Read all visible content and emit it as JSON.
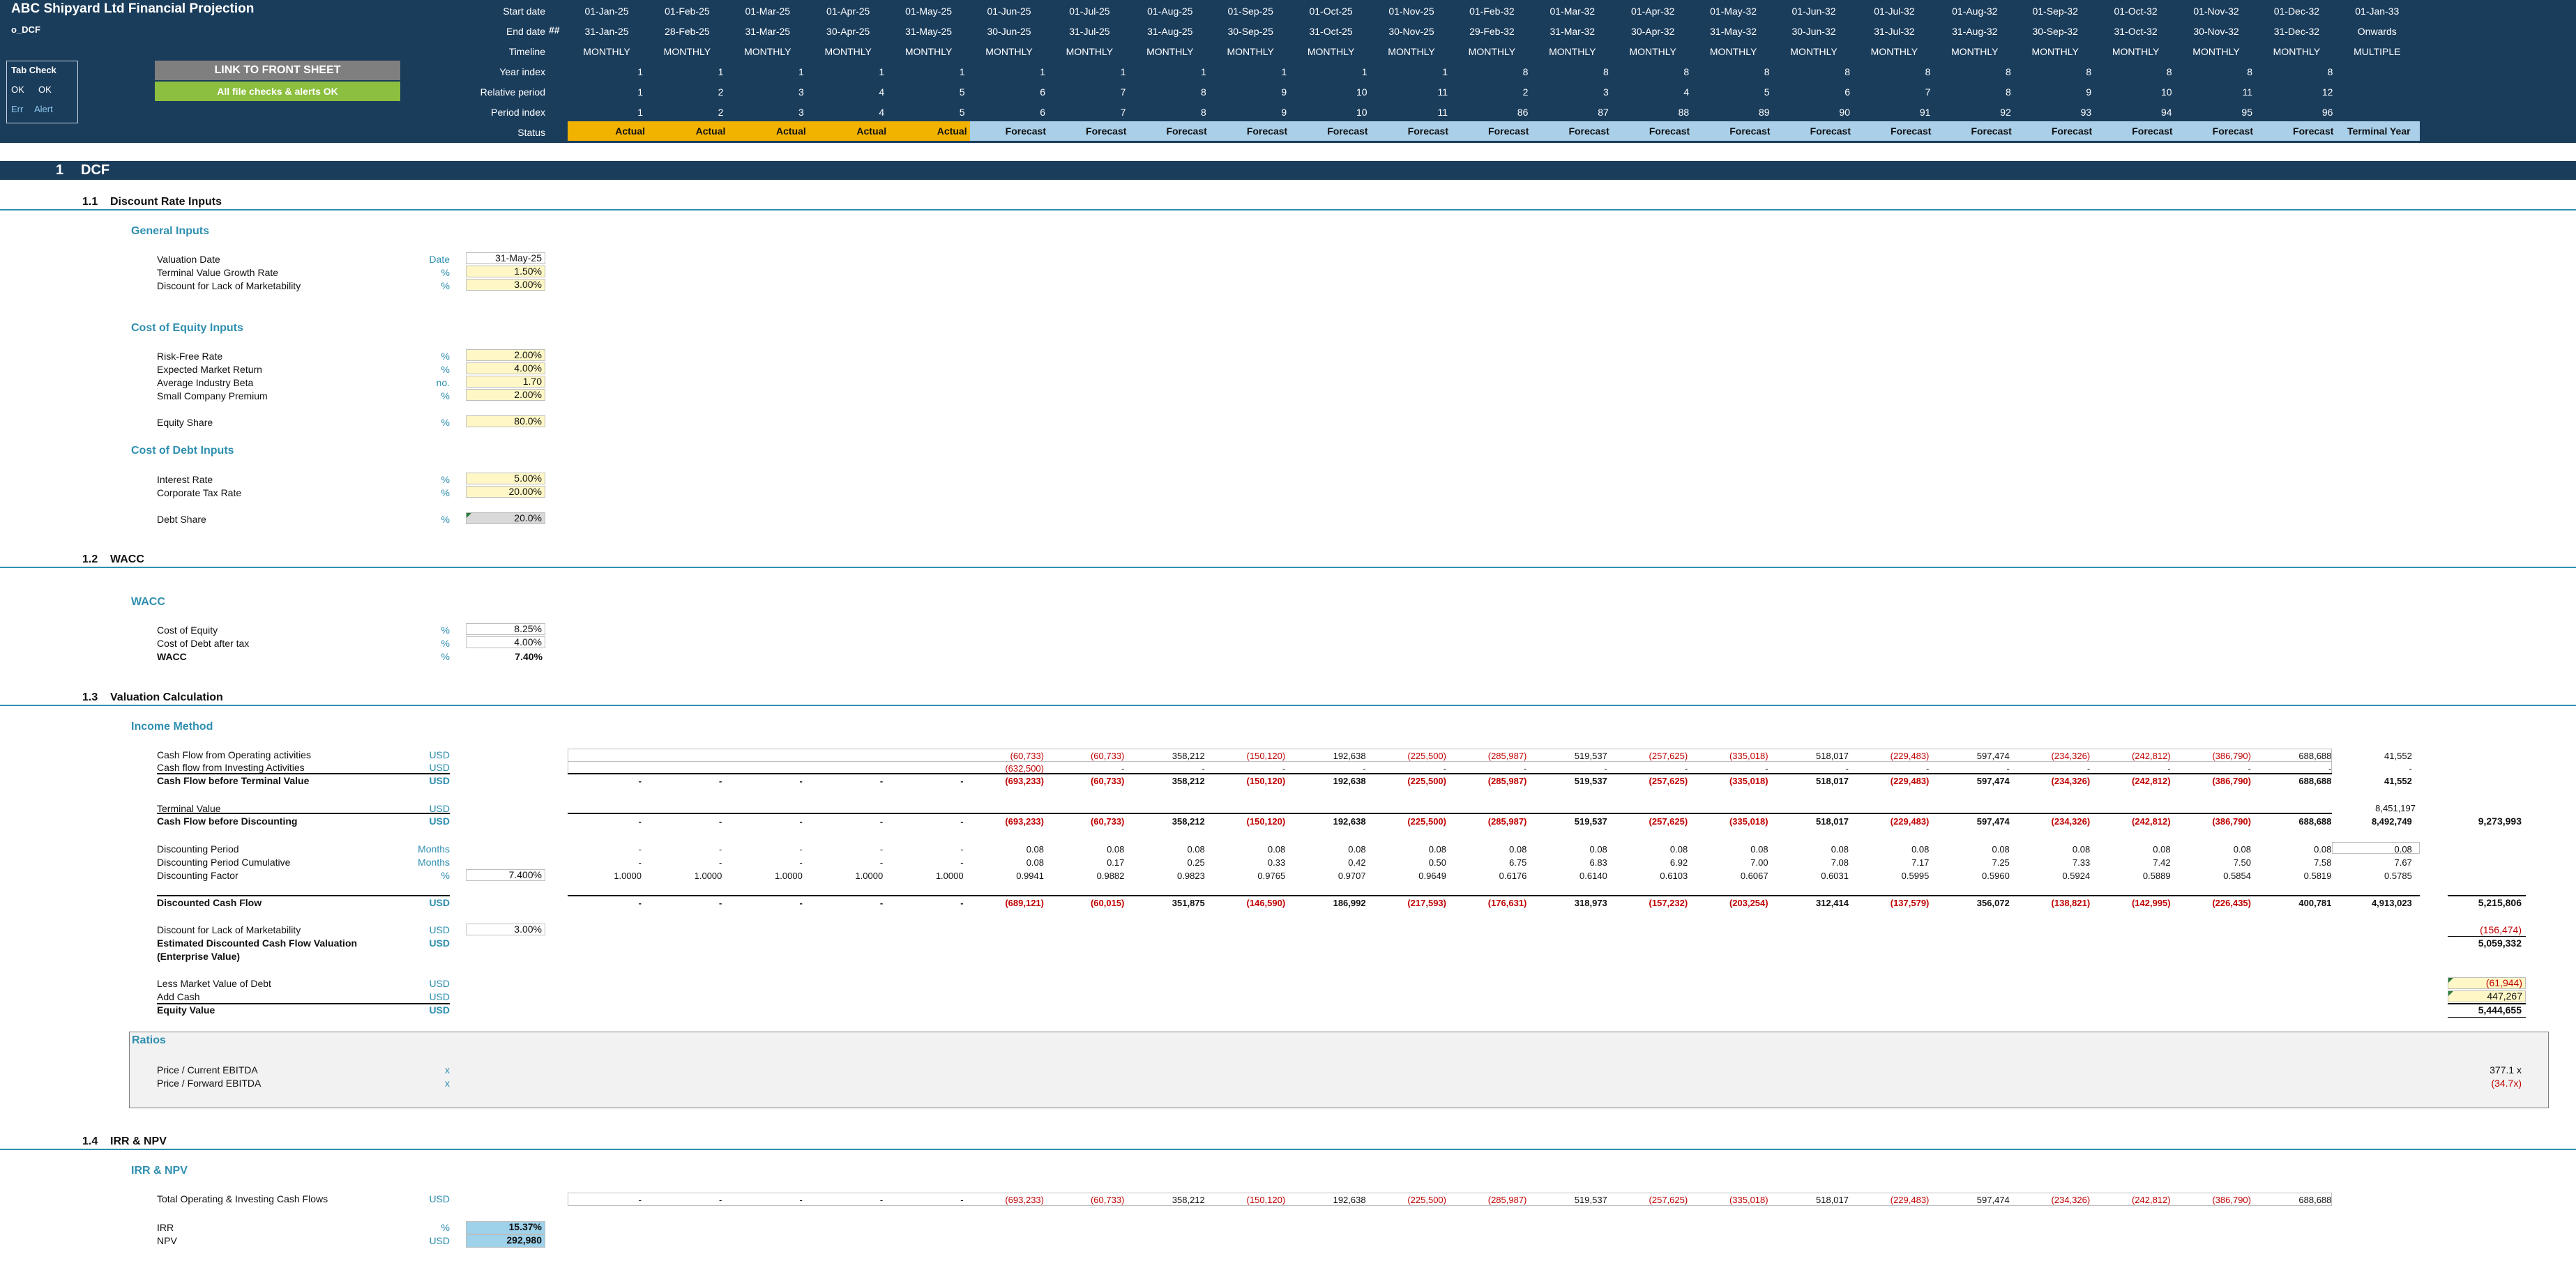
{
  "header": {
    "title": "ABC Shipyard Ltd Financial Projection",
    "sheet": "o_DCF",
    "row_labels": [
      "Start date",
      "End date",
      "Timeline",
      "Year index",
      "Relative period",
      "Period index",
      "Status"
    ],
    "end_date_marker": "##",
    "start_dates": [
      "01-Jan-25",
      "01-Feb-25",
      "01-Mar-25",
      "01-Apr-25",
      "01-May-25",
      "01-Jun-25",
      "01-Jul-25",
      "01-Aug-25",
      "01-Sep-25",
      "01-Oct-25",
      "01-Nov-25",
      "01-Feb-32",
      "01-Mar-32",
      "01-Apr-32",
      "01-May-32",
      "01-Jun-32",
      "01-Jul-32",
      "01-Aug-32",
      "01-Sep-32",
      "01-Oct-32",
      "01-Nov-32",
      "01-Dec-32",
      "01-Jan-33"
    ],
    "end_dates": [
      "31-Jan-25",
      "28-Feb-25",
      "31-Mar-25",
      "30-Apr-25",
      "31-May-25",
      "30-Jun-25",
      "31-Jul-25",
      "31-Aug-25",
      "30-Sep-25",
      "31-Oct-25",
      "30-Nov-25",
      "29-Feb-32",
      "31-Mar-32",
      "30-Apr-32",
      "31-May-32",
      "30-Jun-32",
      "31-Jul-32",
      "31-Aug-32",
      "30-Sep-32",
      "31-Oct-32",
      "30-Nov-32",
      "31-Dec-32",
      "Onwards"
    ],
    "timeline": [
      "MONTHLY",
      "MONTHLY",
      "MONTHLY",
      "MONTHLY",
      "MONTHLY",
      "MONTHLY",
      "MONTHLY",
      "MONTHLY",
      "MONTHLY",
      "MONTHLY",
      "MONTHLY",
      "MONTHLY",
      "MONTHLY",
      "MONTHLY",
      "MONTHLY",
      "MONTHLY",
      "MONTHLY",
      "MONTHLY",
      "MONTHLY",
      "MONTHLY",
      "MONTHLY",
      "MONTHLY",
      "MULTIPLE"
    ],
    "year_index": [
      "1",
      "1",
      "1",
      "1",
      "1",
      "1",
      "1",
      "1",
      "1",
      "1",
      "1",
      "8",
      "8",
      "8",
      "8",
      "8",
      "8",
      "8",
      "8",
      "8",
      "8",
      "8",
      ""
    ],
    "relative_period": [
      "1",
      "2",
      "3",
      "4",
      "5",
      "6",
      "7",
      "8",
      "9",
      "10",
      "11",
      "2",
      "3",
      "4",
      "5",
      "6",
      "7",
      "8",
      "9",
      "10",
      "11",
      "12",
      ""
    ],
    "period_index": [
      "1",
      "2",
      "3",
      "4",
      "5",
      "6",
      "7",
      "8",
      "9",
      "10",
      "11",
      "86",
      "87",
      "88",
      "89",
      "90",
      "91",
      "92",
      "93",
      "94",
      "95",
      "96",
      ""
    ],
    "status": [
      "Actual",
      "Actual",
      "Actual",
      "Actual",
      "Actual",
      "Forecast",
      "Forecast",
      "Forecast",
      "Forecast",
      "Forecast",
      "Forecast",
      "Forecast",
      "Forecast",
      "Forecast",
      "Forecast",
      "Forecast",
      "Forecast",
      "Forecast",
      "Forecast",
      "Forecast",
      "Forecast",
      "Forecast",
      "Terminal Year"
    ]
  },
  "tab_check": {
    "title": "Tab Check",
    "ok1": "OK",
    "ok2": "OK",
    "err": "Err",
    "alert": "Alert"
  },
  "buttons": {
    "link_front": "LINK TO FRONT SHEET",
    "checks_ok": "All file checks & alerts OK"
  },
  "section": {
    "number": "1",
    "title": "DCF"
  },
  "subsections": [
    {
      "number": "1.1",
      "title": "Discount Rate Inputs"
    },
    {
      "number": "1.2",
      "title": "WACC"
    },
    {
      "number": "1.3",
      "title": "Valuation Calculation"
    },
    {
      "number": "1.4",
      "title": "IRR & NPV"
    }
  ],
  "general_inputs": {
    "heading": "General Inputs",
    "rows": [
      {
        "label": "Valuation Date",
        "unit": "Date",
        "value": "31-May-25"
      },
      {
        "label": "Terminal Value Growth Rate",
        "unit": "%",
        "value": "1.50%"
      },
      {
        "label": "Discount for Lack of Marketability",
        "unit": "%",
        "value": "3.00%"
      }
    ]
  },
  "cost_of_equity": {
    "heading": "Cost of Equity Inputs",
    "rows": [
      {
        "label": "Risk-Free Rate",
        "unit": "%",
        "value": "2.00%"
      },
      {
        "label": "Expected Market Return",
        "unit": "%",
        "value": "4.00%"
      },
      {
        "label": "Average Industry Beta",
        "unit": "no.",
        "value": "1.70"
      },
      {
        "label": "Small Company Premium",
        "unit": "%",
        "value": "2.00%"
      },
      {
        "label": "Equity Share",
        "unit": "%",
        "value": "80.0%"
      }
    ]
  },
  "cost_of_debt": {
    "heading": "Cost of Debt Inputs",
    "rows": [
      {
        "label": "Interest Rate",
        "unit": "%",
        "value": "5.00%"
      },
      {
        "label": "Corporate Tax Rate",
        "unit": "%",
        "value": "20.00%"
      },
      {
        "label": "Debt Share",
        "unit": "%",
        "value": "20.0%"
      }
    ]
  },
  "wacc": {
    "heading": "WACC",
    "rows": [
      {
        "label": "Cost of Equity",
        "unit": "%",
        "value": "8.25%"
      },
      {
        "label": "Cost of Debt after tax",
        "unit": "%",
        "value": "4.00%"
      },
      {
        "label": "WACC",
        "unit": "%",
        "value": "7.40%"
      }
    ]
  },
  "income_method": {
    "heading": "Income Method",
    "cfo": {
      "label": "Cash Flow from Operating activities",
      "unit": "USD",
      "values": [
        "",
        "",
        "",
        "",
        "",
        "(60,733)",
        "(60,733)",
        "358,212",
        "(150,120)",
        "192,638",
        "(225,500)",
        "(285,987)",
        "519,537",
        "(257,625)",
        "(335,018)",
        "518,017",
        "(229,483)",
        "597,474",
        "(234,326)",
        "(242,812)",
        "(386,790)",
        "688,688",
        "41,552"
      ]
    },
    "cfi": {
      "label": "Cash flow from Investing Activities",
      "unit": "USD",
      "values": [
        "",
        "",
        "",
        "",
        "",
        "(632,500)",
        "-",
        "-",
        "-",
        "-",
        "-",
        "-",
        "-",
        "-",
        "-",
        "-",
        "-",
        "-",
        "-",
        "-",
        "-",
        "-",
        "-"
      ]
    },
    "cfbtv": {
      "label": "Cash Flow before Terminal Value",
      "unit": "USD",
      "values": [
        "-",
        "-",
        "-",
        "-",
        "-",
        "(693,233)",
        "(60,733)",
        "358,212",
        "(150,120)",
        "192,638",
        "(225,500)",
        "(285,987)",
        "519,537",
        "(257,625)",
        "(335,018)",
        "518,017",
        "(229,483)",
        "597,474",
        "(234,326)",
        "(242,812)",
        "(386,790)",
        "688,688",
        "41,552"
      ]
    },
    "terminal_value": {
      "label": "Terminal Value",
      "unit": "USD",
      "value": "8,451,197"
    },
    "cfbd": {
      "label": "Cash Flow before Discounting",
      "unit": "USD",
      "values": [
        "-",
        "-",
        "-",
        "-",
        "-",
        "(693,233)",
        "(60,733)",
        "358,212",
        "(150,120)",
        "192,638",
        "(225,500)",
        "(285,987)",
        "519,537",
        "(257,625)",
        "(335,018)",
        "518,017",
        "(229,483)",
        "597,474",
        "(234,326)",
        "(242,812)",
        "(386,790)",
        "688,688",
        "8,492,749"
      ],
      "total": "9,273,993"
    },
    "disc_period": {
      "label": "Discounting Period",
      "unit": "Months",
      "values": [
        "-",
        "-",
        "-",
        "-",
        "-",
        "0.08",
        "0.08",
        "0.08",
        "0.08",
        "0.08",
        "0.08",
        "0.08",
        "0.08",
        "0.08",
        "0.08",
        "0.08",
        "0.08",
        "0.08",
        "0.08",
        "0.08",
        "0.08",
        "0.08",
        "0.08"
      ]
    },
    "disc_period_cum": {
      "label": "Discounting Period Cumulative",
      "unit": "Months",
      "values": [
        "-",
        "-",
        "-",
        "-",
        "-",
        "0.08",
        "0.17",
        "0.25",
        "0.33",
        "0.42",
        "0.50",
        "6.75",
        "6.83",
        "6.92",
        "7.00",
        "7.08",
        "7.17",
        "7.25",
        "7.33",
        "7.42",
        "7.50",
        "7.58",
        "7.67"
      ]
    },
    "disc_factor": {
      "label": "Discounting Factor",
      "unit": "%",
      "rate": "7.400%",
      "values": [
        "1.0000",
        "1.0000",
        "1.0000",
        "1.0000",
        "1.0000",
        "0.9941",
        "0.9882",
        "0.9823",
        "0.9765",
        "0.9707",
        "0.9649",
        "0.6176",
        "0.6140",
        "0.6103",
        "0.6067",
        "0.6031",
        "0.5995",
        "0.5960",
        "0.5924",
        "0.5889",
        "0.5854",
        "0.5819",
        "0.5785"
      ]
    },
    "dcf": {
      "label": "Discounted Cash Flow",
      "unit": "USD",
      "values": [
        "-",
        "-",
        "-",
        "-",
        "-",
        "(689,121)",
        "(60,015)",
        "351,875",
        "(146,590)",
        "186,992",
        "(217,593)",
        "(176,631)",
        "318,973",
        "(157,232)",
        "(203,254)",
        "312,414",
        "(137,579)",
        "356,072",
        "(138,821)",
        "(142,995)",
        "(226,435)",
        "400,781",
        "4,913,023"
      ],
      "total": "5,215,806"
    },
    "dlom": {
      "label": "Discount for Lack of Marketability",
      "unit": "USD",
      "rate": "3.00%",
      "total": "(156,474)"
    },
    "est": {
      "label": "Estimated Discounted Cash Flow Valuation",
      "label2": "(Enterprise Value)",
      "unit": "USD",
      "total": "5,059,332"
    },
    "debt": {
      "label": "Less Market Value of Debt",
      "unit": "USD",
      "total": "(61,944)"
    },
    "cash": {
      "label": "Add Cash",
      "unit": "USD",
      "total": "447,267"
    },
    "equity": {
      "label": "Equity Value",
      "unit": "USD",
      "total": "5,444,655"
    }
  },
  "ratios": {
    "heading": "Ratios",
    "rows": [
      {
        "label": "Price / Current EBITDA",
        "unit": "x",
        "value": "377.1 x"
      },
      {
        "label": "Price / Forward EBITDA",
        "unit": "x",
        "value": "(34.7x)"
      }
    ]
  },
  "irr_npv": {
    "heading": "IRR & NPV",
    "total_cf": {
      "label": "Total Operating & Investing Cash Flows",
      "unit": "USD",
      "values": [
        "-",
        "-",
        "-",
        "-",
        "-",
        "(693,233)",
        "(60,733)",
        "358,212",
        "(150,120)",
        "192,638",
        "(225,500)",
        "(285,987)",
        "519,537",
        "(257,625)",
        "(335,018)",
        "518,017",
        "(229,483)",
        "597,474",
        "(234,326)",
        "(242,812)",
        "(386,790)",
        "688,688",
        ""
      ]
    },
    "irr": {
      "label": "IRR",
      "unit": "%",
      "value": "15.37%"
    },
    "npv": {
      "label": "NPV",
      "unit": "USD",
      "value": "292,980"
    }
  }
}
